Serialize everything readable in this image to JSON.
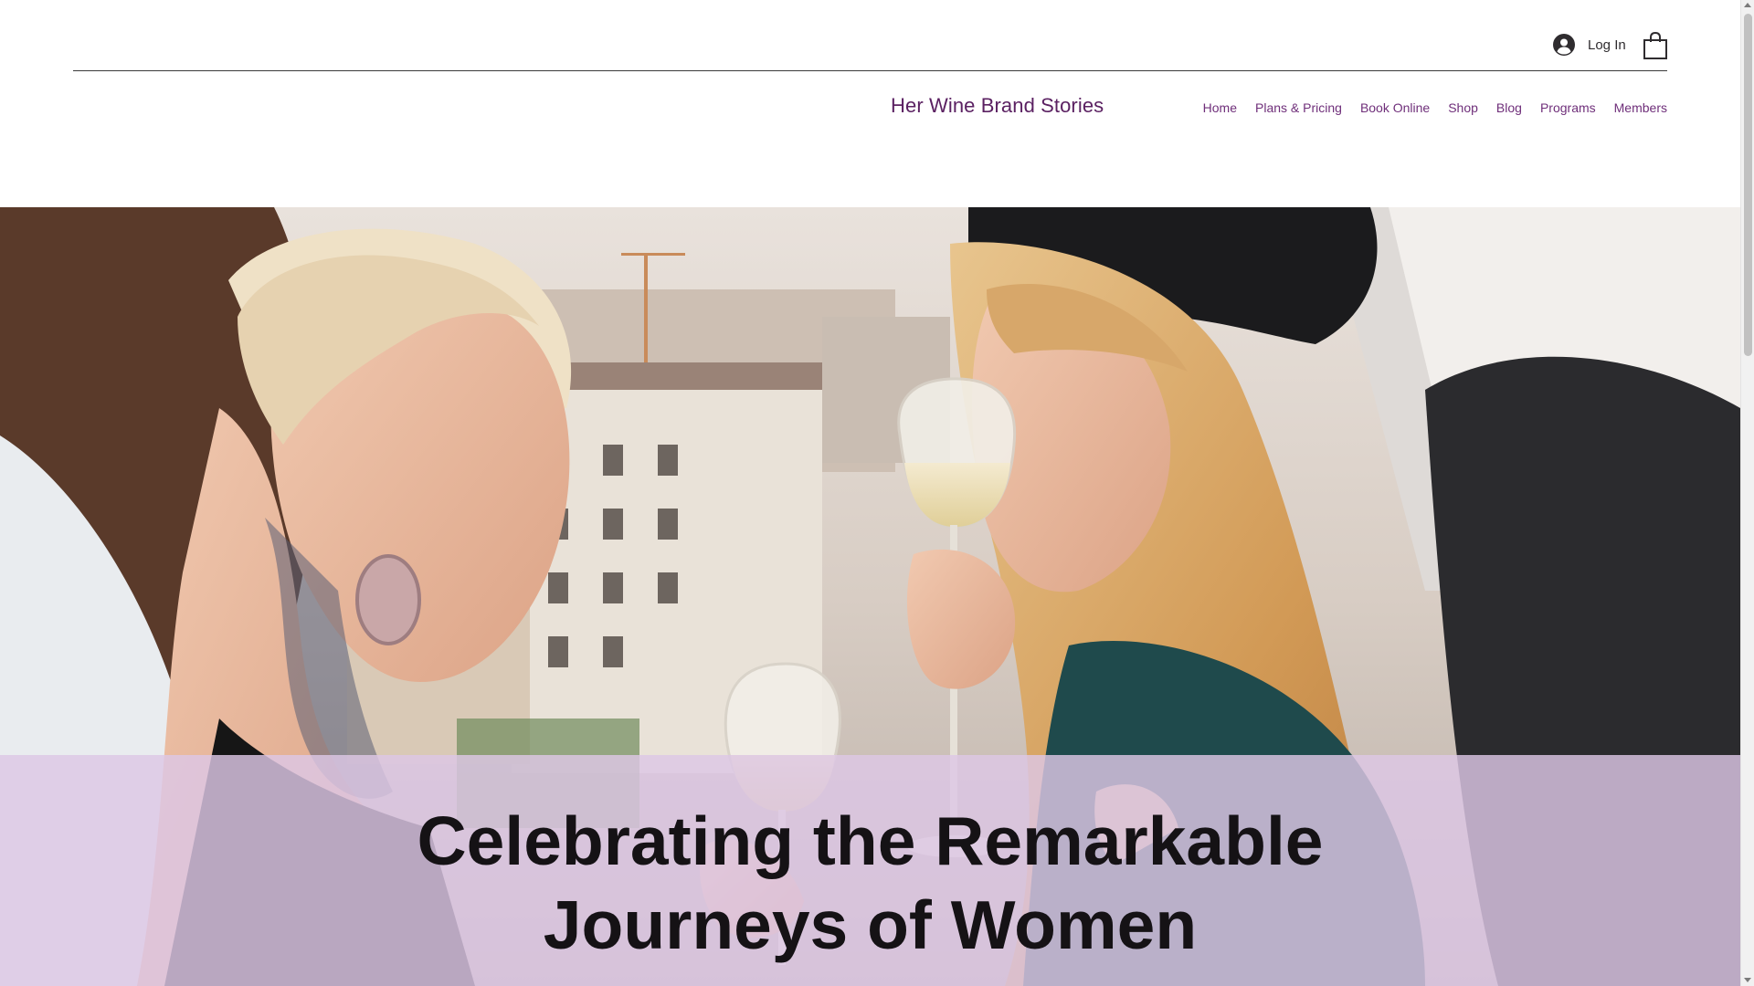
{
  "header": {
    "login_label": "Log In",
    "brand": "Her Wine Brand Stories",
    "nav": [
      {
        "label": "Home"
      },
      {
        "label": "Plans & Pricing"
      },
      {
        "label": "Book Online"
      },
      {
        "label": "Shop"
      },
      {
        "label": "Blog"
      },
      {
        "label": "Programs"
      },
      {
        "label": "Members"
      }
    ],
    "icons": {
      "login": "user-avatar-icon",
      "cart": "shopping-bag-icon"
    }
  },
  "hero": {
    "headline_line1": "Celebrating the Remarkable",
    "headline_line2": "Journeys of Women",
    "image_alt": "Two women laughing and toasting with white wine on a rooftop"
  },
  "colors": {
    "brand": "#5b2162",
    "nav": "#6f2f7a",
    "overlay": "#ddc7e5",
    "headline": "#151215"
  }
}
